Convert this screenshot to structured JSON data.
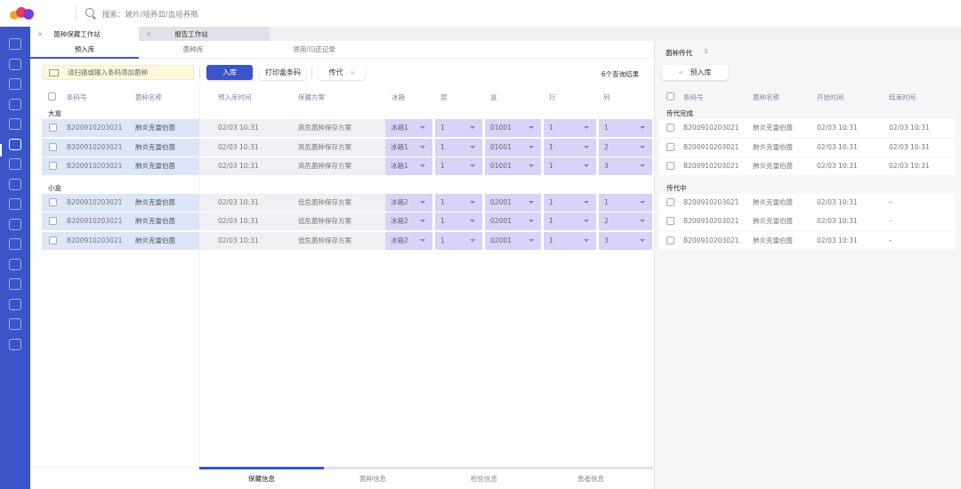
{
  "header": {
    "search_placeholder": "搜索：玻片/培养皿/血培养瓶",
    "logo_colors": [
      "#f5a623",
      "#e8405a",
      "#7a3fd6"
    ]
  },
  "sidebar": {
    "items": [
      "dashboard",
      "stats",
      "report",
      "chart",
      "lab",
      "strain-storage",
      "reagent",
      "sample",
      "bottle",
      "device",
      "analysis",
      "brain",
      "message",
      "medical",
      "monitor",
      "help"
    ],
    "active_index": 5,
    "color": "#3a55c8"
  },
  "window_tabs": [
    {
      "label": "菌种保藏工作站",
      "active": true
    },
    {
      "label": "报告工作站",
      "active": false
    }
  ],
  "sub_tabs": [
    {
      "label": "预入库",
      "active": true
    },
    {
      "label": "菌种库"
    },
    {
      "label": "领用/归还记录"
    }
  ],
  "toolbar": {
    "scan_placeholder": "请扫描或输入条码添加菌种",
    "stock_in": "入库",
    "print_barcode": "打印盒条码",
    "passage": "传代",
    "results": "6个查询结果"
  },
  "table": {
    "headers": [
      "条码号",
      "菌种名称",
      "预入库时间",
      "保藏方案",
      "冰箱",
      "层",
      "盒",
      "行",
      "列"
    ],
    "groups": [
      {
        "label": "大盒",
        "rows": [
          [
            "B200910203021",
            "肺炎克雷伯菌",
            "02/03 10:31",
            "高危菌种保存方案",
            "冰箱1",
            "1",
            "01001",
            "1",
            "1"
          ],
          [
            "B200910203021",
            "肺炎克雷伯菌",
            "02/03 10:31",
            "高危菌种保存方案",
            "冰箱1",
            "1",
            "01001",
            "1",
            "2"
          ],
          [
            "B200910203021",
            "肺炎克雷伯菌",
            "02/03 10:31",
            "高危菌种保存方案",
            "冰箱1",
            "1",
            "01001",
            "1",
            "3"
          ]
        ]
      },
      {
        "label": "小盒",
        "rows": [
          [
            "B200910203021",
            "肺炎克雷伯菌",
            "02/03 10:31",
            "低危菌种保存方案",
            "冰箱2",
            "1",
            "02001",
            "1",
            "1"
          ],
          [
            "B200910203021",
            "肺炎克雷伯菌",
            "02/03 10:31",
            "低危菌种保存方案",
            "冰箱2",
            "1",
            "02001",
            "1",
            "2"
          ],
          [
            "B200910203021",
            "肺炎克雷伯菌",
            "02/03 10:31",
            "低危菌种保存方案",
            "冰箱2",
            "1",
            "02001",
            "1",
            "3"
          ]
        ]
      }
    ]
  },
  "right": {
    "title": "菌种传代",
    "count": "3",
    "back_button": "预入库",
    "headers": [
      "条码号",
      "菌种名称",
      "开始时间",
      "结束时间"
    ],
    "groups": [
      {
        "label": "传代完成",
        "rows": [
          [
            "B200910203021",
            "肺炎克雷伯菌",
            "02/03 10:31",
            "02/03 10:31"
          ],
          [
            "B200910203021",
            "肺炎克雷伯菌",
            "02/03 10:31",
            "02/03 10:31"
          ],
          [
            "B200910203021",
            "肺炎克雷伯菌",
            "02/03 10:31",
            "02/03 10:31"
          ]
        ]
      },
      {
        "label": "传代中",
        "rows": [
          [
            "B200910203021",
            "肺炎克雷伯菌",
            "02/03 10:31",
            "–"
          ],
          [
            "B200910203021",
            "肺炎克雷伯菌",
            "02/03 10:31",
            "–"
          ],
          [
            "B200910203021",
            "肺炎克雷伯菌",
            "02/03 10:31",
            "–"
          ]
        ]
      }
    ]
  },
  "bottom_tabs": [
    {
      "label": "保藏信息",
      "active": true
    },
    {
      "label": "菌种信息"
    },
    {
      "label": "检验信息"
    },
    {
      "label": "患者信息"
    }
  ]
}
